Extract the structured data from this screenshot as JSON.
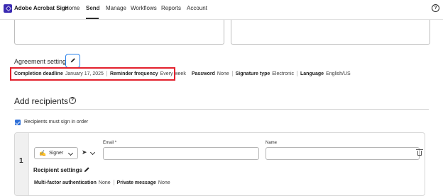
{
  "app": {
    "brand": "Adobe Acrobat Sign"
  },
  "nav": {
    "items": [
      "Home",
      "Send",
      "Manage",
      "Workflows",
      "Reports",
      "Account"
    ],
    "active": "Send"
  },
  "agreement_settings": {
    "title": "Agreement settings",
    "items": [
      {
        "label": "Completion deadline",
        "value": "January 17, 2025"
      },
      {
        "label": "Reminder frequency",
        "value": "Every week"
      },
      {
        "label": "Password",
        "value": "None"
      },
      {
        "label": "Signature type",
        "value": "Electronic"
      },
      {
        "label": "Language",
        "value": "English/US"
      }
    ]
  },
  "recipients": {
    "title": "Add recipients",
    "order_checkbox_label": "Recipients must sign in order",
    "order_checked": true,
    "card": {
      "number": "1",
      "role": "Signer",
      "email_label": "Email",
      "email_required_mark": "*",
      "email_value": "",
      "name_label": "Name",
      "name_value": "",
      "settings_title": "Recipient settings",
      "auth_label": "Multi-factor authentication",
      "auth_value": "None",
      "message_label": "Private message",
      "message_value": "None"
    }
  },
  "colors": {
    "accent": "#2680eb",
    "highlight": "#e3202c",
    "checkbox": "#2e6fd8",
    "brand": "#3b2bb2"
  }
}
